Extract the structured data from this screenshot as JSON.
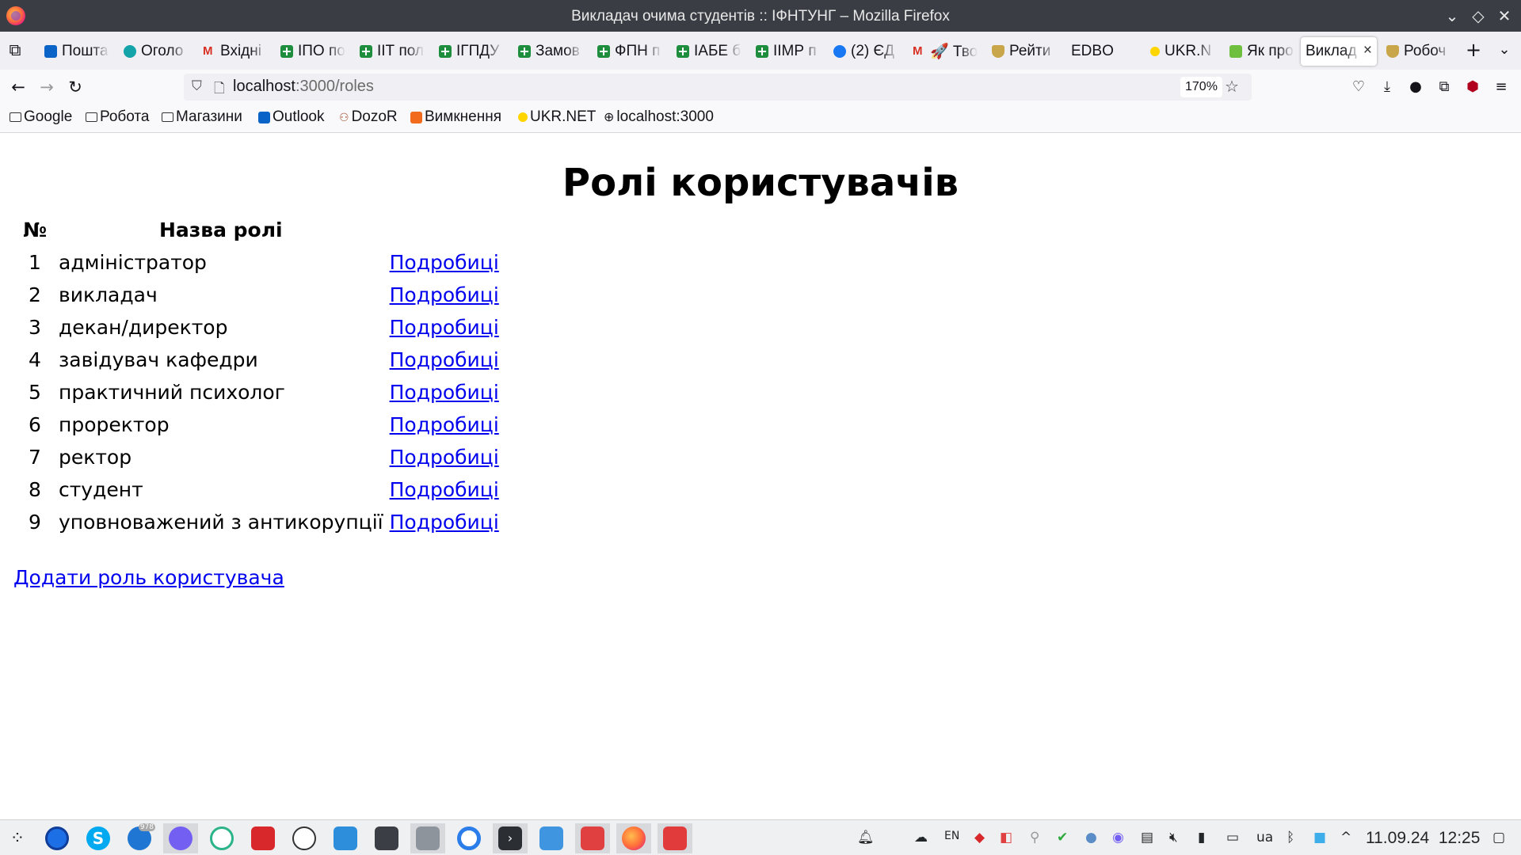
{
  "window": {
    "title": "Викладач очима студентів :: ІФНТУНГ – Mozilla Firefox"
  },
  "tabs": [
    {
      "label": "Пошта",
      "icon": "outlook-icon"
    },
    {
      "label": "Оголо",
      "icon": "announce-icon"
    },
    {
      "label": "Вхідні",
      "icon": "gmail-icon"
    },
    {
      "label": "ІПО по",
      "icon": "sheets-icon"
    },
    {
      "label": "ІІТ пол",
      "icon": "sheets-icon"
    },
    {
      "label": "ІГПДУ",
      "icon": "sheets-icon"
    },
    {
      "label": "Замов",
      "icon": "sheets-icon"
    },
    {
      "label": "ФПН п",
      "icon": "sheets-icon"
    },
    {
      "label": "ІАБЕ б",
      "icon": "sheets-icon"
    },
    {
      "label": "ІІМР п",
      "icon": "sheets-icon"
    },
    {
      "label": "(2) ЄД",
      "icon": "facebook-icon"
    },
    {
      "label": "🚀 Тво",
      "icon": "gmail-icon"
    },
    {
      "label": "Рейти",
      "icon": "shield-icon"
    },
    {
      "label": "EDBO",
      "icon": ""
    },
    {
      "label": "UKR.N",
      "icon": "ukrnet-icon"
    },
    {
      "label": "Як про",
      "icon": "bag-icon"
    },
    {
      "label": "Виклад",
      "icon": "",
      "active": true
    },
    {
      "label": "Робоч",
      "icon": "shield-icon"
    }
  ],
  "navbar": {
    "url_host": "localhost",
    "url_path": ":3000/roles",
    "zoom": "170%"
  },
  "bookmarks": [
    {
      "label": "Google",
      "icon": "folder-icon"
    },
    {
      "label": "Робота",
      "icon": "folder-icon"
    },
    {
      "label": "Магазини",
      "icon": "folder-icon"
    },
    {
      "label": "Outlook",
      "icon": "outlook-icon"
    },
    {
      "label": "DozoR",
      "icon": "dozor-icon"
    },
    {
      "label": "Вимкнення",
      "icon": "power-icon"
    },
    {
      "label": "UKR.NET",
      "icon": "ukrnet-icon"
    },
    {
      "label": "localhost:3000",
      "icon": "globe-icon"
    }
  ],
  "page": {
    "heading": "Ролі користувачів",
    "columns": {
      "num": "№",
      "name": "Назва ролі"
    },
    "roles": [
      {
        "num": "1",
        "name": "адміністратор",
        "link": "Подробиці"
      },
      {
        "num": "2",
        "name": "викладач",
        "link": "Подробиці"
      },
      {
        "num": "3",
        "name": "декан/директор",
        "link": "Подробиці"
      },
      {
        "num": "4",
        "name": "завідувач кафедри",
        "link": "Подробиці"
      },
      {
        "num": "5",
        "name": "практичний психолог",
        "link": "Подробиці"
      },
      {
        "num": "6",
        "name": "проректор",
        "link": "Подробиці"
      },
      {
        "num": "7",
        "name": "ректор",
        "link": "Подробиці"
      },
      {
        "num": "8",
        "name": "студент",
        "link": "Подробиці"
      },
      {
        "num": "9",
        "name": "уповноважений з антикорупції",
        "link": "Подробиці"
      }
    ],
    "add_link": "Додати роль користувача"
  },
  "taskbar": {
    "lang_code": "EN",
    "layout": "ua",
    "date": "11.09.24",
    "time": "12:25",
    "viber_badge": "978"
  },
  "colors": {
    "link": "#0000ee",
    "titlebar": "#3a3e44",
    "tabbar": "#f0f0f4"
  }
}
